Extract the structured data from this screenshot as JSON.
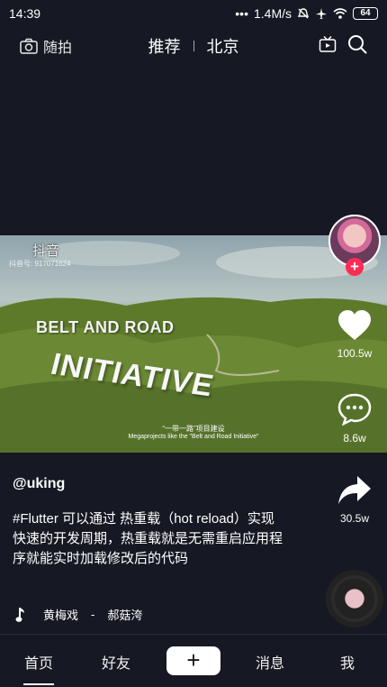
{
  "status_bar": {
    "time": "14:39",
    "network_speed": "1.4M/s",
    "battery": "64"
  },
  "top_bar": {
    "camera_label": "随拍",
    "tabs": [
      "推荐",
      "北京"
    ]
  },
  "video": {
    "watermark_logo": "抖音",
    "watermark_id": "抖音号: 917071624",
    "title_line1": "BELT AND ROAD",
    "title_line2": "INITIATIVE",
    "caption_cn": "“一带一路”项目建设",
    "caption_en": "Megaprojects like the \"Belt and Road Initiative\""
  },
  "actions": {
    "likes": "100.5w",
    "comments": "8.6w",
    "shares": "30.5w"
  },
  "post": {
    "author": "@uking",
    "description": "#Flutter 可以通过 热重载（hot reload）实现快速的开发周期，热重载就是无需重启应用程序就能实时加载修改后的代码",
    "music_title": "黄梅戏",
    "music_separator": "-",
    "music_artist": "郝菇洿"
  },
  "bottom_nav": {
    "home": "首页",
    "friends": "好友",
    "add": "+",
    "messages": "消息",
    "me": "我"
  },
  "colors": {
    "background": "#161823",
    "accent": "#fe2c55"
  }
}
